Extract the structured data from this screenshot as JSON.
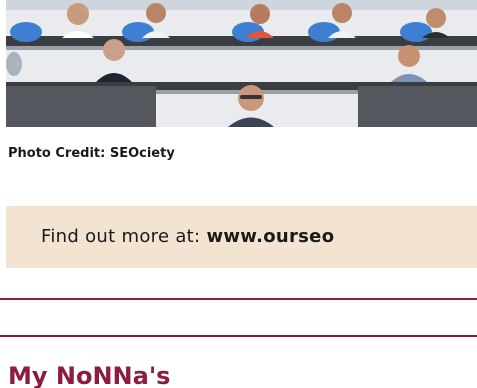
{
  "photo": {
    "alt": "Video call classroom with participants"
  },
  "credit": {
    "text": "Photo Credit: SEOciety"
  },
  "banner": {
    "prefix": "Find out more at: ",
    "url": "www.ourseo"
  },
  "section": {
    "heading": "My NoNNa's"
  },
  "colors": {
    "accent": "#8c1d3d",
    "banner_bg": "#f3e4d2"
  }
}
